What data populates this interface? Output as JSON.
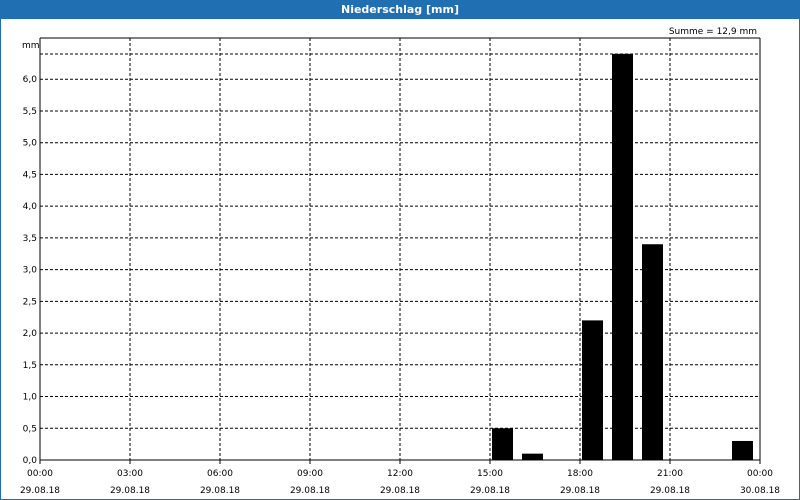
{
  "window": {
    "title": "Niederschlag [mm]"
  },
  "colors": {
    "titlebar": "#1f6fb2",
    "bars": "#000000",
    "grid": "#000000"
  },
  "chart_data": {
    "type": "bar",
    "title": "Niederschlag [mm]",
    "ylabel": "mm",
    "annotation": "Summe = 12,9 mm",
    "ylim": [
      0,
      6.5
    ],
    "y_ticks": [
      "0,0",
      "0,5",
      "1,0",
      "1,5",
      "2,0",
      "2,5",
      "3,0",
      "3,5",
      "4,0",
      "4,5",
      "5,0",
      "5,5",
      "6,0"
    ],
    "x_ticks": [
      {
        "time": "00:00",
        "date": "29.08.18"
      },
      {
        "time": "03:00",
        "date": "29.08.18"
      },
      {
        "time": "06:00",
        "date": "29.08.18"
      },
      {
        "time": "09:00",
        "date": "29.08.18"
      },
      {
        "time": "12:00",
        "date": "29.08.18"
      },
      {
        "time": "15:00",
        "date": "29.08.18"
      },
      {
        "time": "18:00",
        "date": "29.08.18"
      },
      {
        "time": "21:00",
        "date": "29.08.18"
      },
      {
        "time": "00:00",
        "date": "30.08.18"
      }
    ],
    "x_range": [
      "29.08.18 00:00",
      "30.08.18 00:00"
    ],
    "bars": [
      {
        "start": "29.08.18 15:00",
        "end": "29.08.18 16:00",
        "value": 0.5
      },
      {
        "start": "29.08.18 16:00",
        "end": "29.08.18 17:00",
        "value": 0.1
      },
      {
        "start": "29.08.18 18:00",
        "end": "29.08.18 19:00",
        "value": 2.2
      },
      {
        "start": "29.08.18 19:00",
        "end": "29.08.18 20:00",
        "value": 6.4
      },
      {
        "start": "29.08.18 20:00",
        "end": "29.08.18 21:00",
        "value": 3.4
      },
      {
        "start": "29.08.18 23:00",
        "end": "30.08.18 00:00",
        "value": 0.3
      }
    ],
    "grid": true,
    "grid_style": "dashed"
  }
}
